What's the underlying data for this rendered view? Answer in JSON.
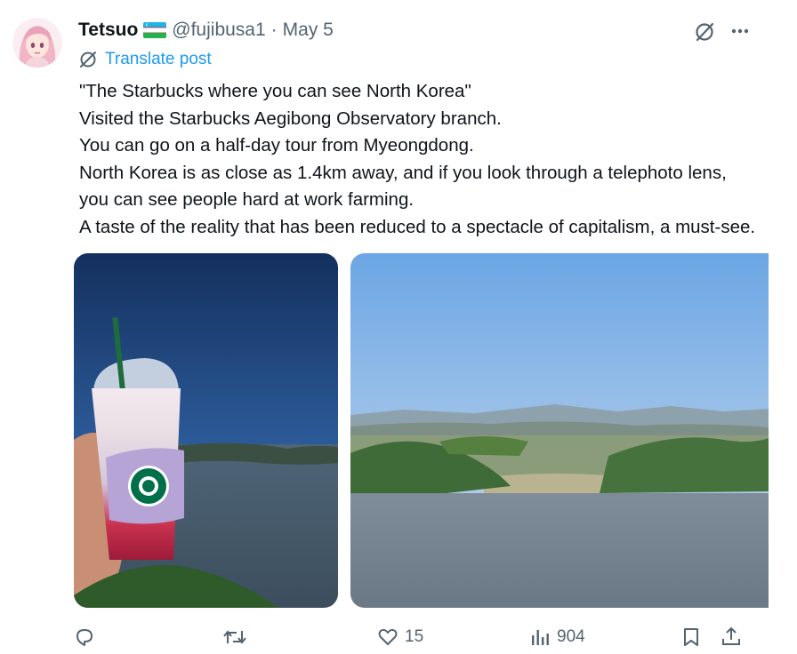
{
  "post": {
    "author_name": "Tetsuo",
    "handle": "@fujibusa1",
    "separator": "·",
    "date": "May 5",
    "translate_label": "Translate post",
    "lines": [
      "\"The Starbucks where you can see North Korea\"",
      "Visited the Starbucks Aegibong Observatory branch.",
      "You can go on a half-day tour from Myeongdong.",
      "North Korea is as close as 1.4km away, and if you look through a telephoto lens,",
      "you can see people hard at work farming.",
      "A taste of the reality that has been reduced to a spectacle of capitalism, a must-see."
    ]
  },
  "actions": {
    "replies": "",
    "reposts": "",
    "likes": "15",
    "views": "904"
  },
  "icons": {
    "reply": "reply-icon",
    "repost": "repost-icon",
    "like": "heart-icon",
    "views": "views-icon",
    "bookmark": "bookmark-icon",
    "share": "share-icon",
    "grok": "grok-icon",
    "more": "more-icon",
    "translate": "translate-icon"
  },
  "colors": {
    "text": "#0f1419",
    "secondary": "#536471",
    "link": "#1d9bf0"
  }
}
